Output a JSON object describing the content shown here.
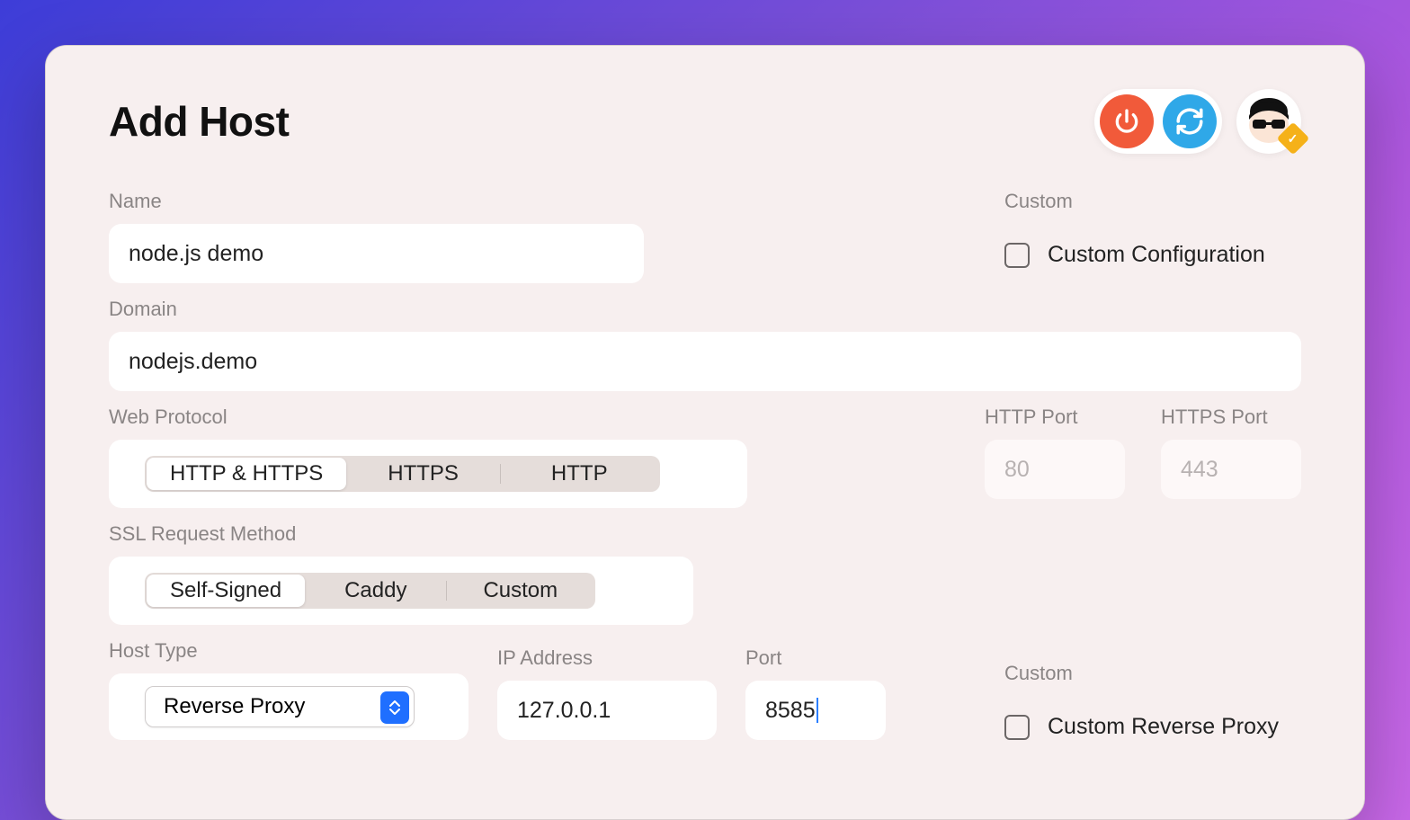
{
  "title": "Add Host",
  "header": {
    "power_tooltip": "Power",
    "refresh_tooltip": "Refresh"
  },
  "name": {
    "label": "Name",
    "value": "node.js demo"
  },
  "domain": {
    "label": "Domain",
    "value": "nodejs.demo"
  },
  "custom_top": {
    "label": "Custom",
    "checkbox_label": "Custom Configuration",
    "checked": false
  },
  "web_protocol": {
    "label": "Web Protocol",
    "options": [
      "HTTP & HTTPS",
      "HTTPS",
      "HTTP"
    ],
    "selected_index": 0
  },
  "http_port": {
    "label": "HTTP Port",
    "placeholder": "80",
    "value": ""
  },
  "https_port": {
    "label": "HTTPS Port",
    "placeholder": "443",
    "value": ""
  },
  "ssl_method": {
    "label": "SSL Request Method",
    "options": [
      "Self-Signed",
      "Caddy",
      "Custom"
    ],
    "selected_index": 0
  },
  "host_type": {
    "label": "Host Type",
    "value": "Reverse Proxy"
  },
  "ip_address": {
    "label": "IP Address",
    "value": "127.0.0.1"
  },
  "port": {
    "label": "Port",
    "value": "8585"
  },
  "custom_bottom": {
    "label": "Custom",
    "checkbox_label": "Custom Reverse Proxy",
    "checked": false
  }
}
